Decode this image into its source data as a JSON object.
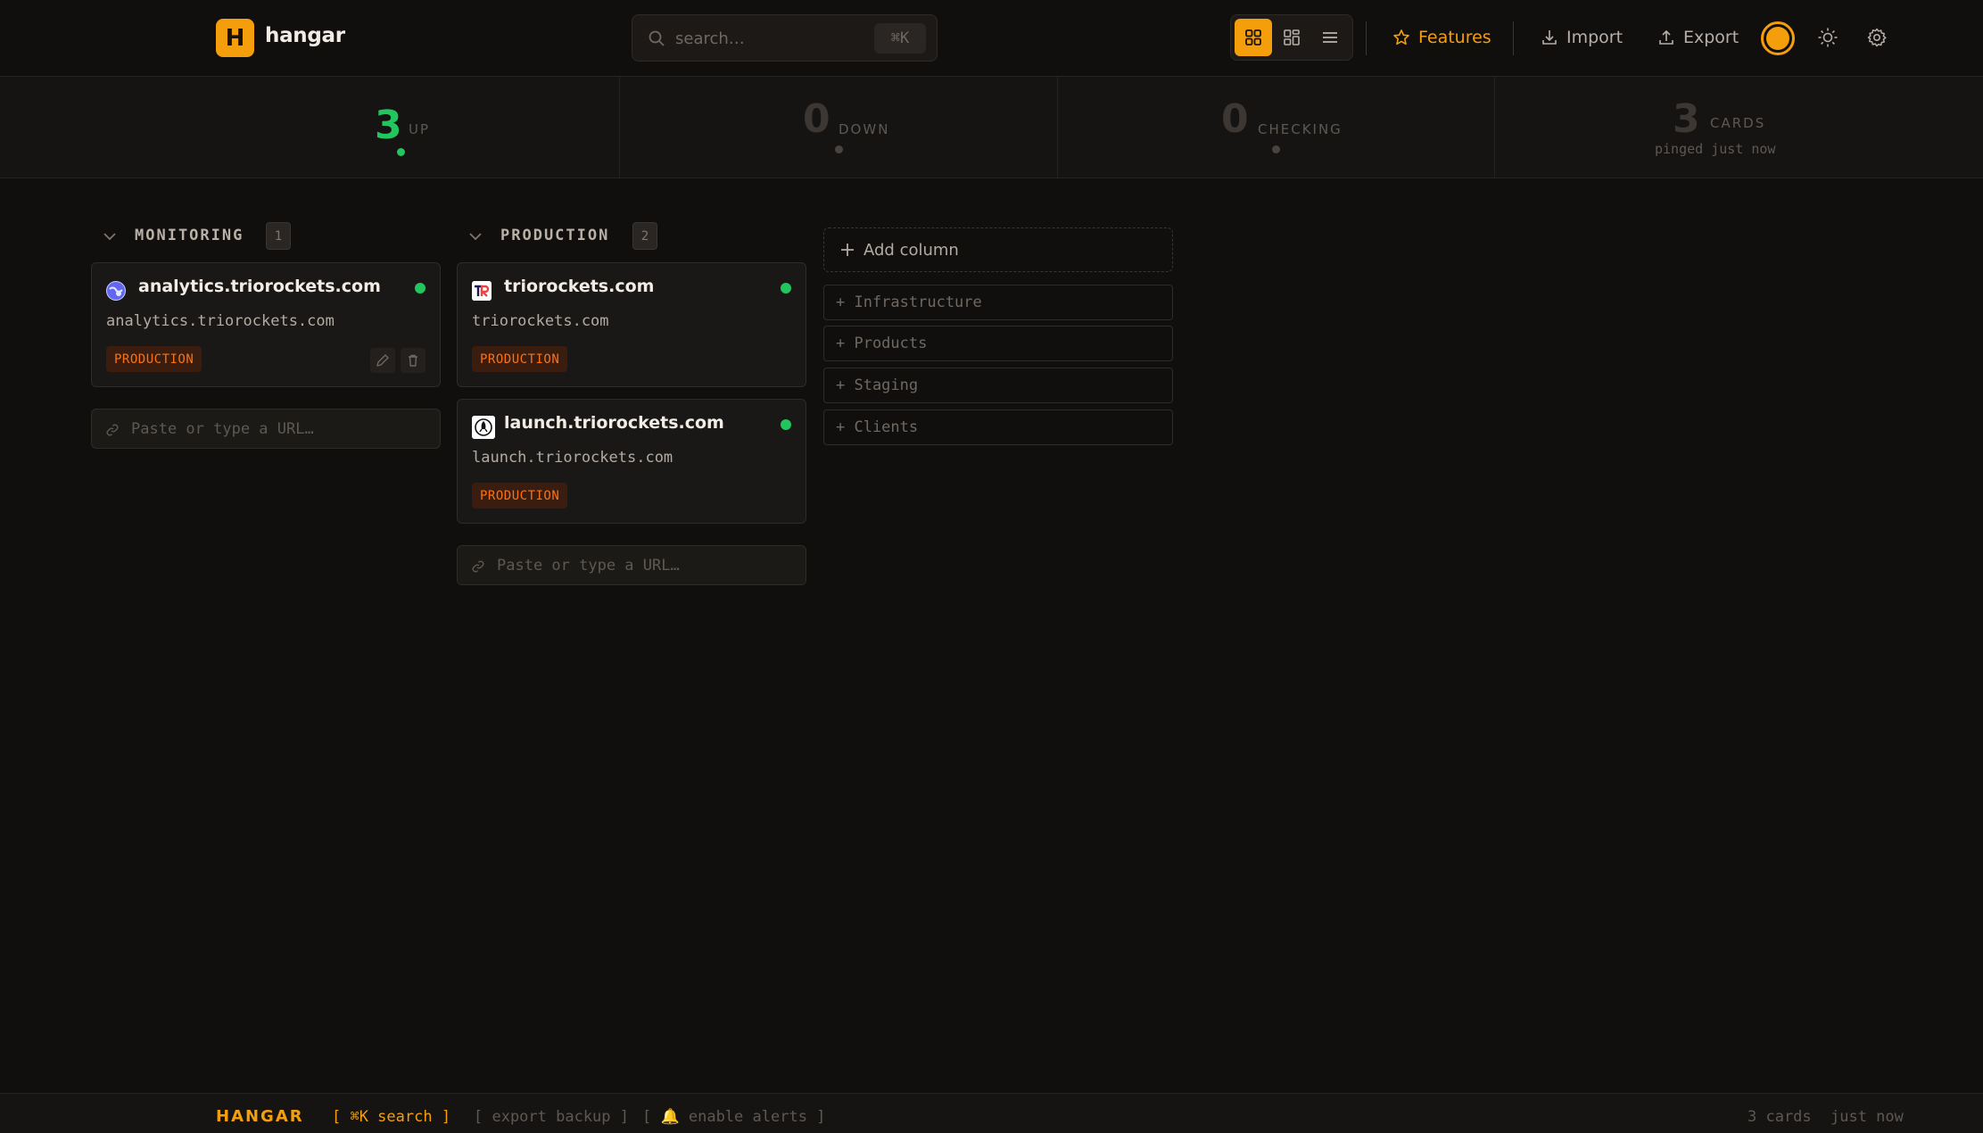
{
  "app": {
    "logo_letter": "H",
    "name": "hangar"
  },
  "search": {
    "placeholder": "search…",
    "shortcut": "⌘K"
  },
  "toolbar": {
    "views": [
      "grid-view",
      "compact-grid-view",
      "list-view"
    ],
    "active_view": "grid-view",
    "features_label": "Features",
    "import_label": "Import",
    "export_label": "Export"
  },
  "stats": {
    "up": {
      "value": "3",
      "label": "UP"
    },
    "down": {
      "value": "0",
      "label": "DOWN"
    },
    "checking": {
      "value": "0",
      "label": "CHECKING"
    },
    "cards": {
      "value": "3",
      "label": "CARDS",
      "sub": "pinged just now"
    }
  },
  "columns": [
    {
      "title": "MONITORING",
      "count": "1",
      "cards": [
        {
          "title": "analytics.triorockets.com",
          "url": "analytics.triorockets.com",
          "tag": "PRODUCTION",
          "status": "up"
        }
      ],
      "input_placeholder": "Paste or type a URL…"
    },
    {
      "title": "PRODUCTION",
      "count": "2",
      "cards": [
        {
          "title": "triorockets.com",
          "url": "triorockets.com",
          "tag": "PRODUCTION",
          "status": "up"
        },
        {
          "title": "launch.triorockets.com",
          "url": "launch.triorockets.com",
          "tag": "PRODUCTION",
          "status": "up"
        }
      ],
      "input_placeholder": "Paste or type a URL…"
    }
  ],
  "add_column": {
    "label": "Add column",
    "suggestions": [
      "+ Infrastructure",
      "+ Products",
      "+ Staging",
      "+ Clients"
    ]
  },
  "footer": {
    "brand": "HANGAR",
    "search": "[ ⌘K search ]",
    "backup": "[ export backup ]",
    "alerts": "[ 🔔 enable alerts ]",
    "card_count": "3 cards",
    "updated": "just now"
  },
  "colors": {
    "accent": "#f59e0b",
    "up": "#22c55e",
    "tag": "#f97316",
    "background": "#110f0e"
  }
}
